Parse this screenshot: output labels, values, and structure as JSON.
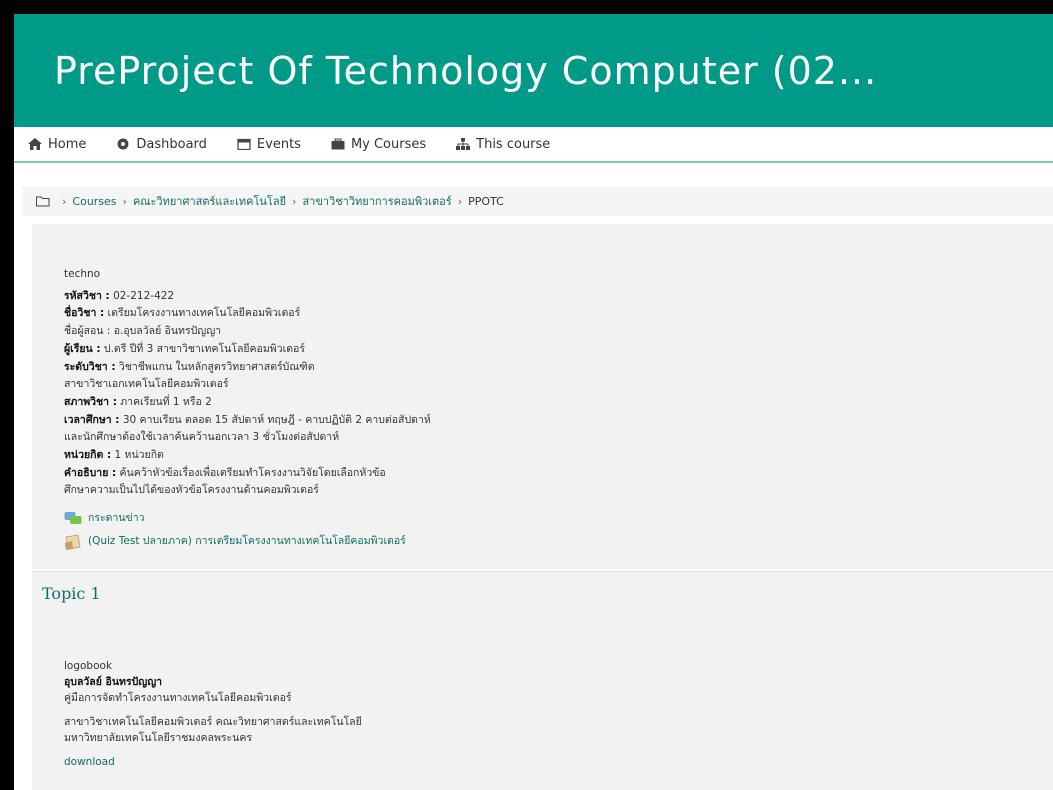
{
  "header": {
    "site_title": "PreProject Of Technology Computer (02..."
  },
  "nav": {
    "items": [
      {
        "label": "Home",
        "icon": "home-icon"
      },
      {
        "label": "Dashboard",
        "icon": "dashboard-icon"
      },
      {
        "label": "Events",
        "icon": "calendar-icon"
      },
      {
        "label": "My Courses",
        "icon": "courses-icon"
      },
      {
        "label": "This course",
        "icon": "sitemap-icon"
      }
    ]
  },
  "breadcrumb": {
    "items": [
      "Courses",
      "คณะวิทยาศาสตร์และเทคโนโลยี",
      "สาขาวิชาวิทยาการคอมพิวเตอร์"
    ],
    "current": "PPOTC"
  },
  "section0": {
    "image_caption": "techno",
    "lines": [
      {
        "label": "รหัสวิชา :",
        "value": " 02-212-422"
      },
      {
        "label": "ชื่อวิชา :",
        "value": " เตรียมโครงงานทางเทคโนโลยีคอมพิวเตอร์"
      },
      {
        "label": "",
        "value": "ชื่อผู้สอน : อ.อุบลวัลย์ อินทรปัญญา"
      },
      {
        "label": "ผู้เรียน :",
        "value": " ป.ตรี ปีที่ 3 สาขาวิชาเทคโนโลยีคอมพิวเตอร์"
      },
      {
        "label": "ระดับวิชา :",
        "value": " วิชาชีพแกน ในหลักสูตรวิทยาศาสตร์บัณฑิต"
      },
      {
        "label": "",
        "value": "สาขาวิชาเอกเทคโนโลยีคอมพิวเตอร์"
      },
      {
        "label": "สภาพวิชา :",
        "value": " ภาคเรียนที่ 1 หรือ 2"
      },
      {
        "label": "เวลาศึกษา :",
        "value": " 30 คาบเรียน ตลอด 15 สัปดาห์ ทฤษฎี - คาบปฏิบัติ 2 คาบต่อสัปดาห์"
      },
      {
        "label": "",
        "value": "และนักศึกษาต้องใช้เวลาค้นคว้านอกเวลา 3 ชั่วโมงต่อสัปดาห์"
      },
      {
        "label": "หน่วยกิต :",
        "value": " 1 หน่วยกิต"
      },
      {
        "label": "คำอธิบาย :",
        "value": " ค้นคว้าหัวข้อเรื่องเพื่อเตรียมทำโครงงานวิจัยโดยเลือกหัวข้อ"
      },
      {
        "label": "",
        "value": "ศึกษาความเป็นไปได้ของหัวข้อโครงงานด้านคอมพิวเตอร์"
      }
    ],
    "activities": [
      {
        "label": "กระดานข่าว",
        "icon": "forum-icon"
      },
      {
        "label": "(Quiz Test ปลายภาค) การเตรียมโครงงานทางเทคโนโลยีคอมพิวเตอร์",
        "icon": "quiz-icon"
      }
    ]
  },
  "topic1": {
    "title": "Topic 1",
    "image_caption": "logobook",
    "author": "อุบลวัลย์ อินทรปัญญา",
    "subtitle": "คู่มือการจัดทำโครงงานทางเทคโนโลยีคอมพิวเตอร์",
    "dept_line1": "สาขาวิชาเทคโนโลยีคอมพิวเตอร์ คณะวิทยาศาสตร์และเทคโนโลยี",
    "dept_line2": "มหาวิทยาลัยเทคโนโลยีราชมงคลพระนคร",
    "download": "download"
  },
  "colors": {
    "brand": "#009a88",
    "link": "#0e6d64",
    "section_bg": "#f2f2f2"
  }
}
